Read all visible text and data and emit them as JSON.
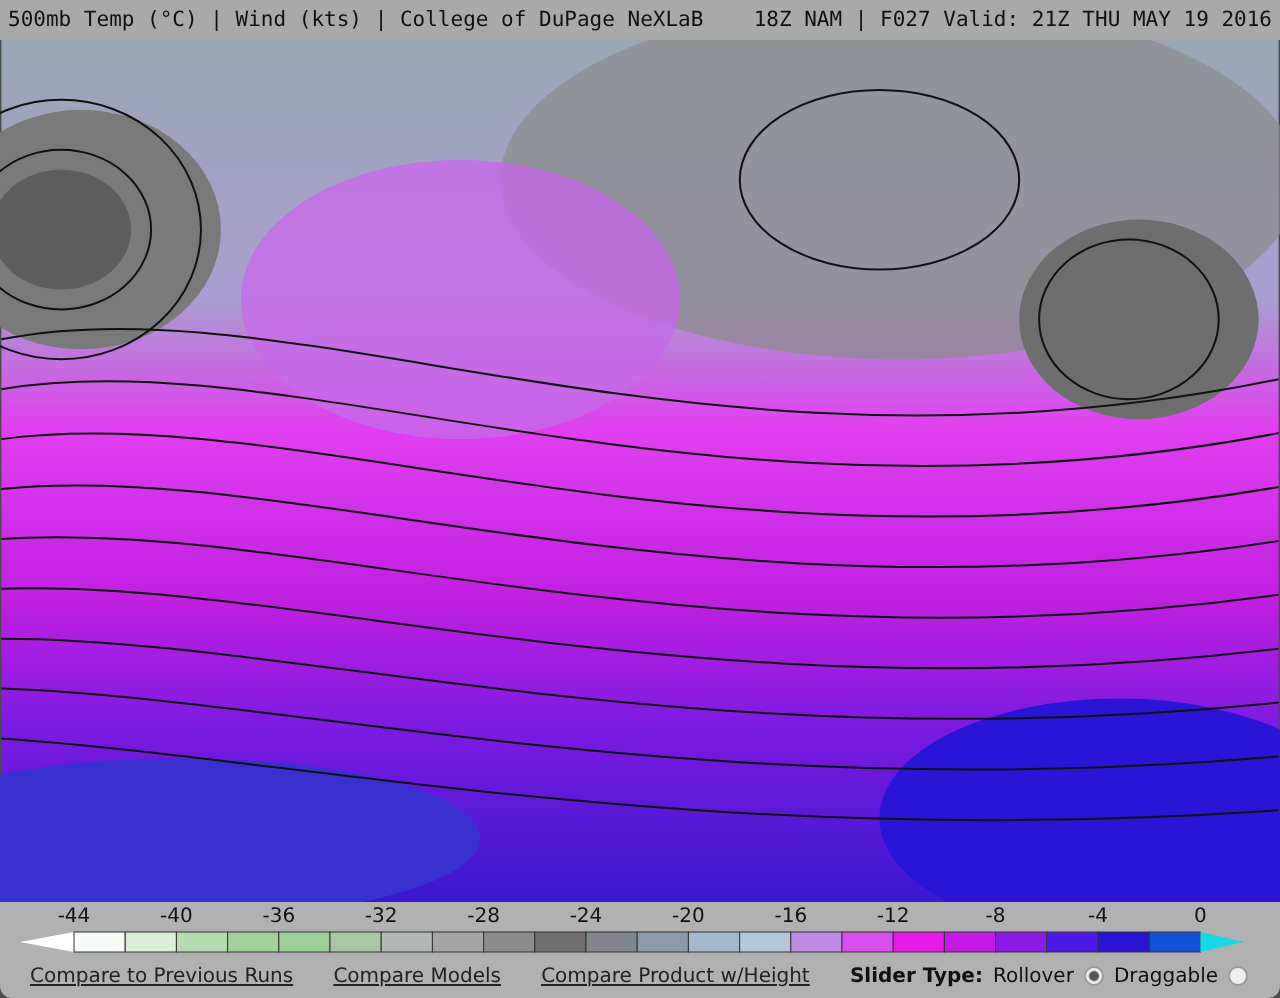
{
  "header": {
    "left": "500mb Temp (°C) | Wind (kts) | College of DuPage NeXLaB",
    "right": "18Z NAM | F027 Valid: 21Z THU MAY 19 2016"
  },
  "colorbar": {
    "ticks": [
      "-44",
      "-40",
      "-36",
      "-32",
      "-28",
      "-24",
      "-20",
      "-16",
      "-12",
      "-8",
      "-4",
      "0"
    ]
  },
  "links": [
    "Compare to Previous Runs",
    "Compare Models",
    "Compare Product w/Height"
  ],
  "slider_type": {
    "label": "Slider Type:",
    "options": [
      {
        "label": "Rollover",
        "selected": true
      },
      {
        "label": "Draggable",
        "selected": false
      }
    ]
  }
}
